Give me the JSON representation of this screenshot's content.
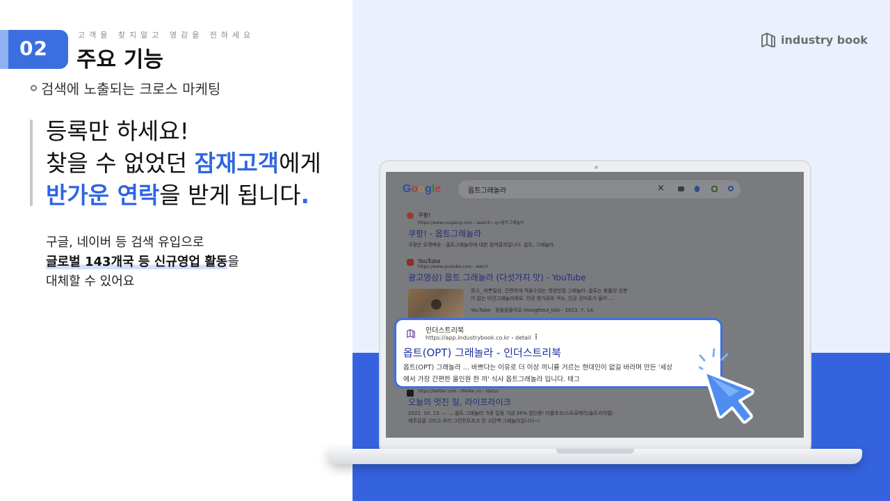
{
  "header": {
    "number": "02",
    "tagline": "고객을 찾지말고 영감을 전하세요",
    "title": "주요 기능",
    "subtitle": "검색에 노출되는 크로스 마케팅"
  },
  "headline": {
    "line1": "등록만 하세요!",
    "line2_pre": "찾을 수 없었던 ",
    "line2_hl": "잠재고객",
    "line2_post": "에게",
    "line3_hl": "반가운 연락",
    "line3_post": "을 받게 됩니다",
    "line3_dot": "."
  },
  "description": {
    "line1": "구글, 네이버 등 검색 유입으로",
    "line2_strong": "글로벌 143개국 등 신규영업 활동",
    "line2_post": "을",
    "line3": "대체할 수 있어요"
  },
  "logo": {
    "text": "industry book",
    "icon": "book-icon"
  },
  "browser": {
    "google_logo": [
      "G",
      "o",
      "o",
      "g",
      "l",
      "e"
    ],
    "search_query": "옵트그래놀라",
    "results": [
      {
        "site": "쿠팡!",
        "url": "https://www.coupang.com › search › q=옵트그래놀라",
        "title": "쿠팡! - 옵트그래놀라",
        "snippet": "쿠팡은 로켓배송 - 옵트그래놀라에 대한 검색결과입니다. 옵트, 그래놀라."
      },
      {
        "site": "YouTube",
        "url": "https://www.youtube.com › watch",
        "title": "광고영상) 옵트 그래놀라 (다섯가지 맛) - YouTube",
        "snippet1": "광고_ 바쁜일상, 간편하게 먹을수있는 영양만점 그래놀라. 옵트는 동물성 성분",
        "snippet2": "이 없는 비건그래놀라에요. 인공 첨가료와 색소, 인공 감미료가 들어 ...",
        "meta": "YouTube · 뭉틀뭉뜰이오 mongtteul_tolo · 2023. 7. 14."
      },
      {
        "site": "X",
        "url": "https://twitter.com › lifelike_co › status",
        "title": "오늘의 멋진 일, 라이프라이크",
        "snippet1": "2022. 10. 13. — ... 옵트 그래놀라' 5종 입점 기념 26% 할인중! 더블초코/스트로베리/솔트카라멜/",
        "snippet2": "제주감귤 그리고 우리 그린민트초코 맛 고단백 그래놀라입니다~!"
      }
    ],
    "highlight": {
      "site": "인더스트리북",
      "url": "https://app.industrybook.co.kr › detail",
      "title": "옵트(OPT) 그래놀라 - 인더스트리북",
      "snippet1": "옵트(OPT) 그래놀라 ... 바쁘다는 이유로 더 이상 끼니를 거르는 현대인이 없길 바라며 만든 '세상",
      "snippet2": "에서 가장 간편한 올인원 한 끼' 식사 옵트그래놀라 입니다. 태그"
    }
  },
  "colors": {
    "accent": "#2f66e0",
    "pill": "#3b6fe0",
    "light_bg": "#eaf1fc",
    "blue_bg": "#3563e0"
  }
}
